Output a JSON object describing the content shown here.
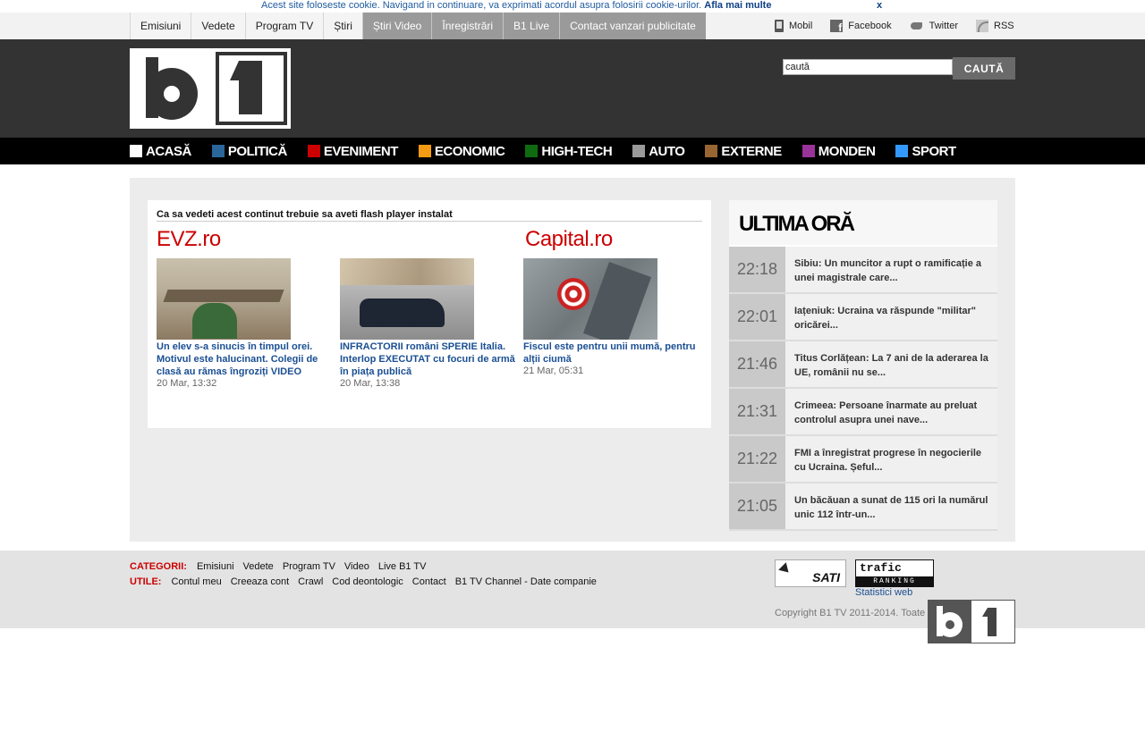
{
  "cookie": {
    "message": "Acest site foloseste cookie. Navigand in continuare, va exprimati acordul asupra folosirii cookie-urilor.",
    "more_label": "Afla mai multe",
    "close_label": "x"
  },
  "topnav": {
    "items": [
      "Emisiuni",
      "Vedete",
      "Program TV",
      "Știri",
      "Știri Video",
      "Înregistrări",
      "B1 Live",
      "Contact vanzari publicitate"
    ],
    "social": [
      {
        "label": "Mobil",
        "icon": "mobile-icon"
      },
      {
        "label": "Facebook",
        "icon": "facebook-icon"
      },
      {
        "label": "Twitter",
        "icon": "twitter-icon"
      },
      {
        "label": "RSS",
        "icon": "rss-icon"
      }
    ]
  },
  "header": {
    "logo_alt": "B1",
    "search_value": "caută",
    "search_button": "CAUTĂ"
  },
  "categories": [
    {
      "label": "ACASĂ",
      "color": "#ffffff"
    },
    {
      "label": "POLITICĂ",
      "color": "#2a6699"
    },
    {
      "label": "EVENIMENT",
      "color": "#cc0000"
    },
    {
      "label": "ECONOMIC",
      "color": "#f39c12"
    },
    {
      "label": "HIGH-TECH",
      "color": "#0f6b0f"
    },
    {
      "label": "AUTO",
      "color": "#9a9a9a"
    },
    {
      "label": "EXTERNE",
      "color": "#996633"
    },
    {
      "label": "MONDEN",
      "color": "#993399"
    },
    {
      "label": "SPORT",
      "color": "#3399ff"
    }
  ],
  "flash": {
    "note": "Ca sa vedeti acest continut trebuie sa aveti flash player instalat",
    "brand_left": "EVZ.ro",
    "brand_right": "Capital.ro",
    "stories": [
      {
        "title": "Un elev s-a sinucis în timpul orei. Motivul este halucinant. Colegii de clasă au rămas îngroziți VIDEO",
        "date": "20 Mar, 13:32"
      },
      {
        "title": "INFRACTORII români SPERIE Italia. Interlop EXECUTAT cu focuri de armă în piața publică",
        "date": "20 Mar, 13:38"
      },
      {
        "title": "Fiscul este pentru unii mumă, pentru alții ciumă",
        "date": "21 Mar, 05:31"
      }
    ]
  },
  "ultima": {
    "heading": "ULTIMA ORĂ",
    "items": [
      {
        "time": "22:18",
        "text": "Sibiu: Un muncitor a rupt o ramificație a unei magistrale care..."
      },
      {
        "time": "22:01",
        "text": "Iațeniuk: Ucraina va răspunde \"militar\" oricărei..."
      },
      {
        "time": "21:46",
        "text": "Titus Corlățean: La 7 ani de la aderarea la UE, românii nu se..."
      },
      {
        "time": "21:31",
        "text": "Crimeea: Persoane înarmate au preluat controlul asupra unei nave..."
      },
      {
        "time": "21:22",
        "text": "FMI a înregistrat progrese în negocierile cu Ucraina. Șeful..."
      },
      {
        "time": "21:05",
        "text": "Un băcăuan a sunat de 115 ori la numărul unic 112 într-un..."
      }
    ]
  },
  "footer": {
    "categorii_label": "CATEGORII:",
    "categorii": [
      "Emisiuni",
      "Vedete",
      "Program TV",
      "Video",
      "Live B1 TV"
    ],
    "utile_label": "UTILE:",
    "utile": [
      "Contul meu",
      "Creeaza cont",
      "Crawl",
      "Cod deontologic",
      "Contact",
      "B1 TV Channel - Date companie"
    ],
    "sati": "SATI",
    "trafic_top": "trafic",
    "trafic_bottom": "RANKING",
    "stats": "Statistici web",
    "copyright": "Copyright B1 TV 2011-2014. Toate drepturile rezervate"
  }
}
